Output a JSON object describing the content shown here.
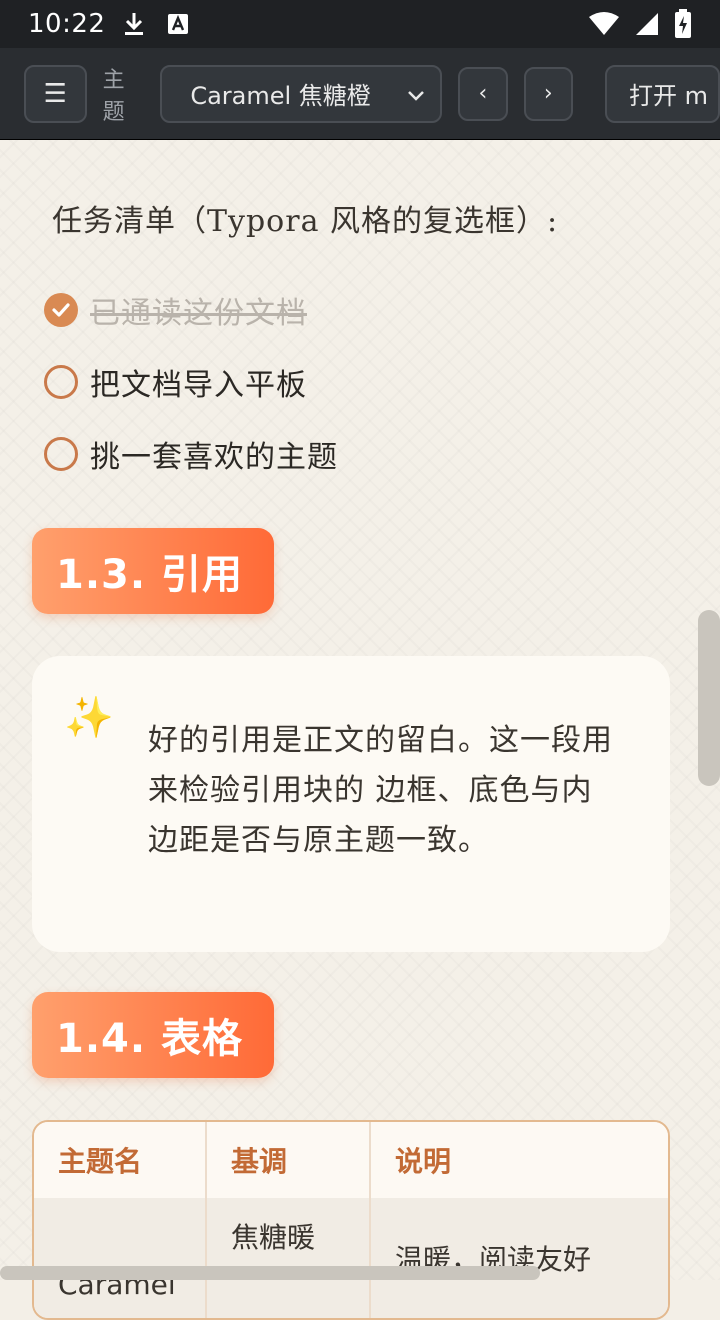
{
  "status_bar": {
    "time": "10:22",
    "icons": [
      "download-icon",
      "a-icon",
      "wifi-icon",
      "signal-icon",
      "battery-icon"
    ]
  },
  "toolbar": {
    "menu_icon": "☰",
    "theme_label": "主题",
    "theme_value": "Caramel 焦糖橙",
    "prev_label": "‹",
    "next_label": "›",
    "open_label": "打开 m"
  },
  "tasks": {
    "heading": "任务清单（Typora 风格的复选框）:",
    "items": [
      {
        "label": "已通读这份文档",
        "checked": true
      },
      {
        "label": "把文档导入平板",
        "checked": false
      },
      {
        "label": "挑一套喜欢的主题",
        "checked": false
      }
    ]
  },
  "quote_section": {
    "title": "1.3. 引用",
    "icon": "✨",
    "text": "好的引用是正文的留白。这一段用来检验引用块的 边框、底色与内边距是否与原主题一致。"
  },
  "table_section": {
    "title": "1.4. 表格",
    "headers": [
      "主题名",
      "基调",
      "说明"
    ],
    "rows": [
      [
        "Caramel",
        "焦糖暖",
        "温暖，阅读友好"
      ]
    ]
  },
  "colors": {
    "accent": "#ff6a37",
    "accent_light": "#ffa06d",
    "check": "#d98a53",
    "table_header_text": "#c26a35"
  }
}
